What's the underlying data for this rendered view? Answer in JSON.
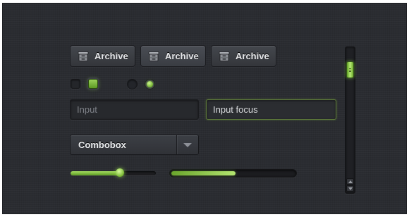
{
  "buttons": [
    {
      "label": "Archive",
      "icon": "archive-icon"
    },
    {
      "label": "Archive",
      "icon": "archive-icon"
    },
    {
      "label": "Archive",
      "icon": "archive-icon"
    }
  ],
  "checkboxes": [
    {
      "checked": false
    },
    {
      "checked": true
    }
  ],
  "radios": [
    {
      "selected": false
    },
    {
      "selected": true
    }
  ],
  "inputs": {
    "normal": {
      "value": "Input"
    },
    "focus": {
      "value": "Input focus"
    }
  },
  "combobox": {
    "value": "Combobox",
    "icon": "chevron-down-icon"
  },
  "slider": {
    "value_fraction": 0.58
  },
  "progress": {
    "value_fraction": 0.52
  },
  "scrollbar": {
    "position_fraction": 0.1,
    "up_icon": "arrow-up-icon",
    "down_icon": "arrow-down-icon"
  },
  "colors": {
    "background": "#2a2c31",
    "accent": "#8fcf4a",
    "text": "#e6e7ea",
    "muted_text": "#7d8087"
  }
}
